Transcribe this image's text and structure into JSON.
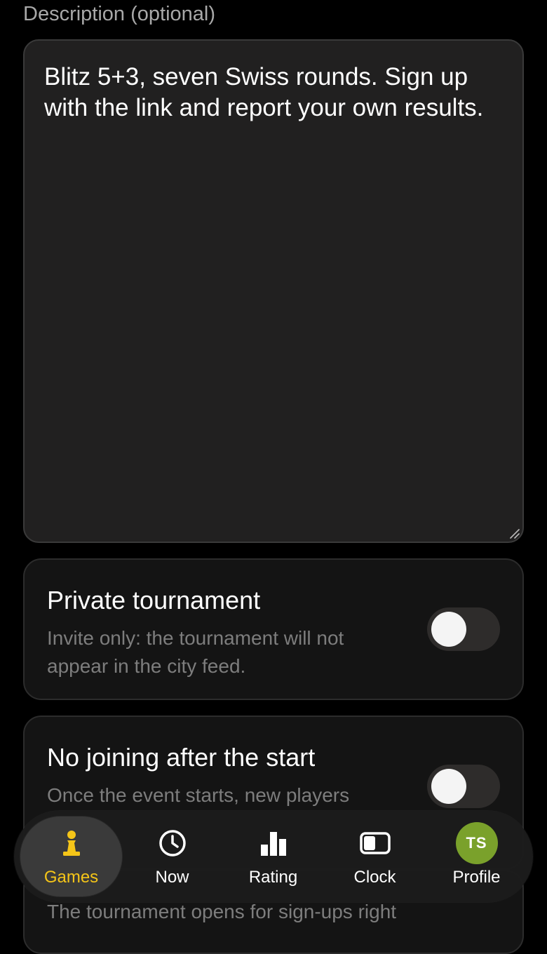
{
  "description": {
    "label": "Description (optional)",
    "value": "Blitz 5+3, seven Swiss rounds. Sign up with the link and report your own results."
  },
  "settings": [
    {
      "title": "Private tournament",
      "description": "Invite only: the tournament will not appear in the city feed.",
      "enabled": false
    },
    {
      "title": "No joining after the start",
      "description": "Once the event starts, new players",
      "enabled": false
    }
  ],
  "partial_card_text": "The tournament opens for sign-ups right",
  "tabbar": {
    "active": "games",
    "items": [
      {
        "id": "games",
        "label": "Games",
        "icon": "pawn-icon"
      },
      {
        "id": "now",
        "label": "Now",
        "icon": "clock-icon"
      },
      {
        "id": "rating",
        "label": "Rating",
        "icon": "bar-chart-icon"
      },
      {
        "id": "clock",
        "label": "Clock",
        "icon": "chess-clock-icon"
      },
      {
        "id": "profile",
        "label": "Profile",
        "icon": "avatar",
        "initials": "TS"
      }
    ]
  },
  "colors": {
    "accent": "#f5c518",
    "avatar": "#7aa12b",
    "background": "#000000",
    "card": "#141414",
    "textarea": "#212020"
  }
}
